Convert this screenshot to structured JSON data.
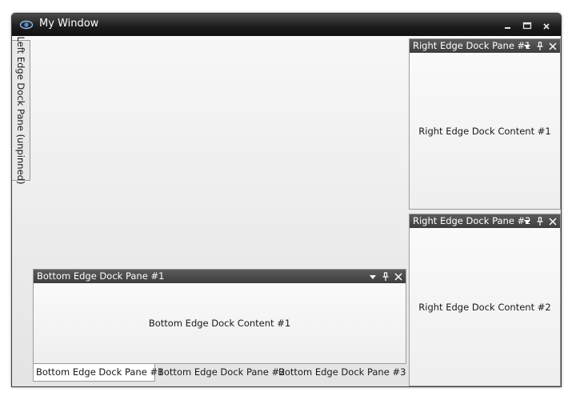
{
  "window": {
    "title": "My Window",
    "controls": {
      "minimize": "minimize-icon",
      "maximize": "maximize-icon",
      "close": "close-icon"
    }
  },
  "left_dock": {
    "unpinned_tab_label": "Left Edge Dock Pane (unpinned)"
  },
  "right_dock": {
    "panes": [
      {
        "title": "Right Edge Dock Pane #1",
        "content": "Right Edge Dock Content #1"
      },
      {
        "title": "Right Edge Dock Pane #2",
        "content": "Right Edge Dock Content #2"
      }
    ]
  },
  "bottom_dock": {
    "active_pane": {
      "title": "Bottom Edge Dock Pane #1",
      "content": "Bottom Edge Dock Content #1"
    },
    "tabs": [
      {
        "label": "Bottom Edge Dock Pane #1",
        "active": true
      },
      {
        "label": "Bottom Edge Dock Pane #2",
        "active": false
      },
      {
        "label": "Bottom Edge Dock Pane #3",
        "active": false
      }
    ]
  },
  "colors": {
    "titlebar": "#1c1c1c",
    "pane_header": "#4a4a4a",
    "background": "#ececec"
  }
}
